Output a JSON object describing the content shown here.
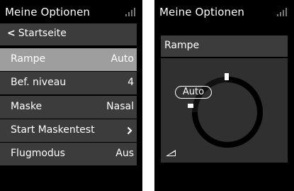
{
  "left_screen": {
    "title": "Meine Optionen",
    "signal_icon": "signal-bars-icon",
    "back": {
      "label": "Startseite",
      "icon": "chevron-left-icon"
    },
    "items": [
      {
        "label": "Rampe",
        "value": "Auto",
        "selected": true
      },
      {
        "label": "Bef. niveau",
        "value": "4",
        "selected": false
      },
      {
        "label": "Maske",
        "value": "Nasal",
        "selected": false
      },
      {
        "label": "Start Maskentest",
        "value": "",
        "icon": "chevron-right-icon",
        "selected": false
      },
      {
        "label": "Flugmodus",
        "value": "Aus",
        "selected": false
      }
    ]
  },
  "right_screen": {
    "title": "Meine Optionen",
    "signal_icon": "signal-bars-icon",
    "panel": {
      "title": "Rampe",
      "value_badge": "Auto",
      "dial_icon": "ramp-icon"
    }
  },
  "colors": {
    "background": "#000000",
    "row": "#3c3c3c",
    "selected_row": "#9e9e9e",
    "panel": "#303030",
    "text": "#ffffff"
  }
}
